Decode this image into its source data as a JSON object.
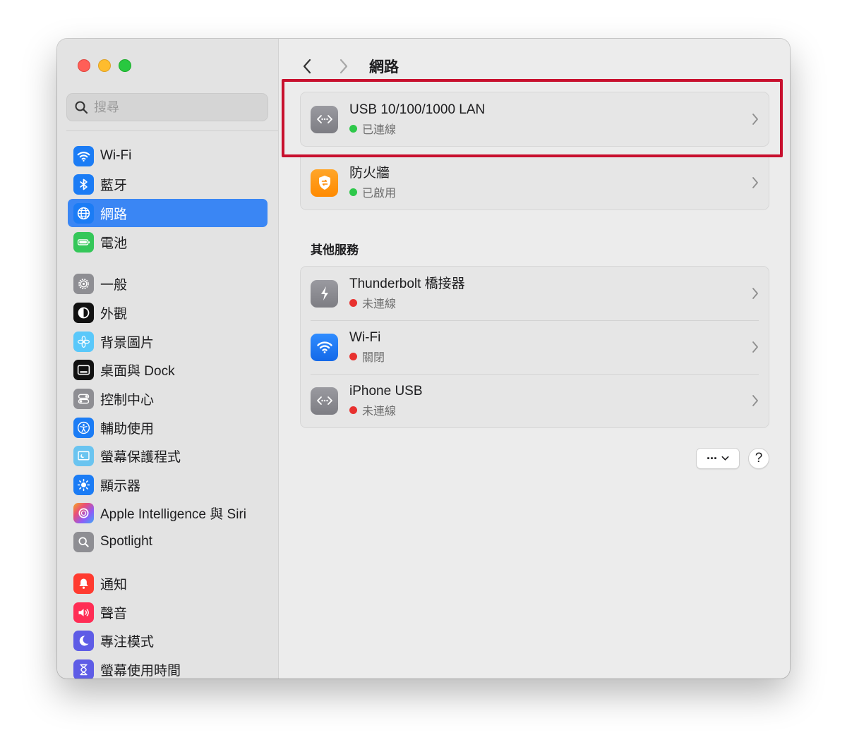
{
  "search": {
    "placeholder": "搜尋"
  },
  "sidebar": {
    "items": [
      {
        "label": "Wi-Fi",
        "icon": "wifi-icon",
        "color": "#1b7cf5"
      },
      {
        "label": "藍牙",
        "icon": "bluetooth-icon",
        "color": "#1b7cf5"
      },
      {
        "label": "網路",
        "icon": "globe-icon",
        "color": "#1b7cf5",
        "selected": true
      },
      {
        "label": "電池",
        "icon": "battery-icon",
        "color": "#34c759"
      },
      {
        "label": "一般",
        "icon": "gear-icon",
        "color": "#8e8e93"
      },
      {
        "label": "外觀",
        "icon": "appearance-icon",
        "color": "#111111"
      },
      {
        "label": "背景圖片",
        "icon": "flower-icon",
        "color": "#5ac8fa"
      },
      {
        "label": "桌面與 Dock",
        "icon": "dock-icon",
        "color": "#111111"
      },
      {
        "label": "控制中心",
        "icon": "toggles-icon",
        "color": "#8e8e93"
      },
      {
        "label": "輔助使用",
        "icon": "accessibility-icon",
        "color": "#1b7cf5"
      },
      {
        "label": "螢幕保護程式",
        "icon": "screensaver-icon",
        "color": "#6ac4f0"
      },
      {
        "label": "顯示器",
        "icon": "sun-icon",
        "color": "#1b7cf5"
      },
      {
        "label": "Apple Intelligence 與 Siri",
        "icon": "siri-icon",
        "color": "#c86dd7"
      },
      {
        "label": "Spotlight",
        "icon": "magnifier-icon",
        "color": "#8e8e93"
      },
      {
        "label": "通知",
        "icon": "bell-icon",
        "color": "#ff3b30"
      },
      {
        "label": "聲音",
        "icon": "speaker-icon",
        "color": "#ff2d55"
      },
      {
        "label": "專注模式",
        "icon": "moon-icon",
        "color": "#5e5ce6"
      },
      {
        "label": "螢幕使用時間",
        "icon": "hourglass-icon",
        "color": "#5e5ce6"
      }
    ]
  },
  "main": {
    "title": "網路",
    "top_services": [
      {
        "title": "USB 10/100/1000 LAN",
        "status": "已連線",
        "status_color": "green",
        "icon": "ethernet-icon"
      },
      {
        "title": "防火牆",
        "status": "已啟用",
        "status_color": "green",
        "icon": "firewall-icon"
      }
    ],
    "other_title": "其他服務",
    "other_services": [
      {
        "title": "Thunderbolt 橋接器",
        "status": "未連線",
        "status_color": "red",
        "icon": "thunderbolt-icon"
      },
      {
        "title": "Wi-Fi",
        "status": "關閉",
        "status_color": "red",
        "icon": "wifi-icon"
      },
      {
        "title": "iPhone USB",
        "status": "未連線",
        "status_color": "red",
        "icon": "ethernet-icon"
      }
    ],
    "more_button": "···",
    "help_button": "?"
  }
}
